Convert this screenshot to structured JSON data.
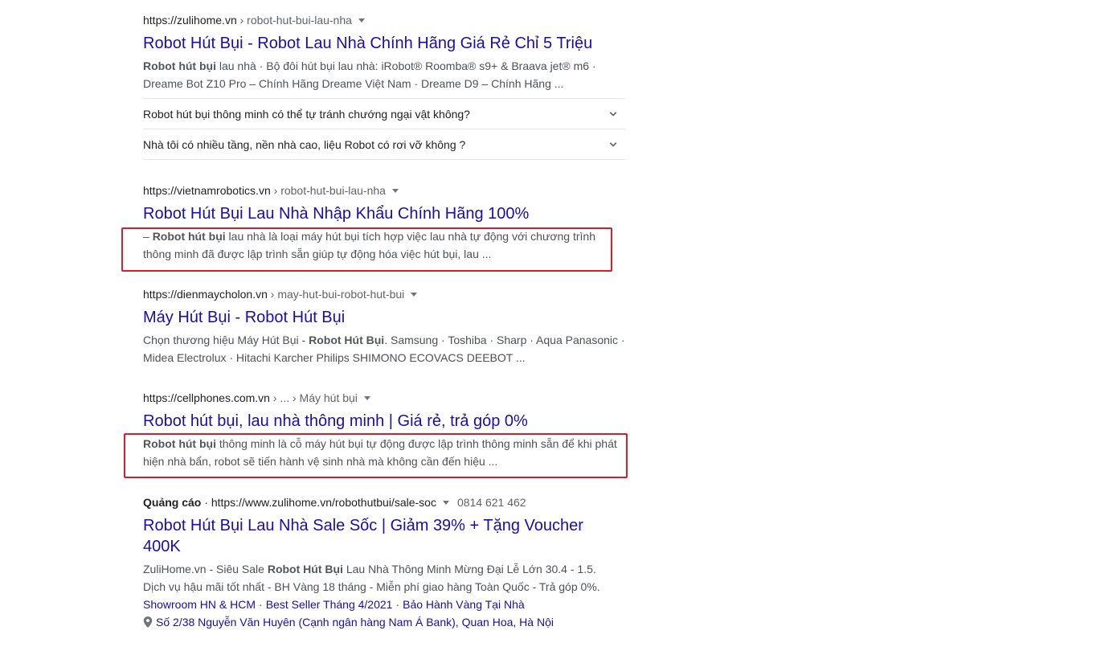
{
  "results": [
    {
      "domain": "https://zulihome.vn",
      "path": " › robot-hut-bui-lau-nha",
      "title": "Robot Hút Bụi - Robot Lau Nhà Chính Hãng Giá Rẻ Chỉ 5 Triệu",
      "snippet_bold": "Robot hút bụi",
      "snippet_line1_rest": " lau nhà · Bộ đôi hút bụi lau nhà: iRobot® Roomba® s9+ & Braava jet® m6 ·",
      "snippet_line2": "Dreame Bot Z10 Pro – Chính Hãng Dreame Việt Nam · Dreame D9 – Chính Hãng ..."
    },
    {
      "domain": "https://vietnamrobotics.vn",
      "path": " › robot-hut-bui-lau-nha",
      "title": "Robot Hút Bụi Lau Nhà Nhập Khẩu Chính Hãng 100%",
      "snippet_pre": "– ",
      "snippet_bold": "Robot hút bụi",
      "snippet_line1_rest": " lau nhà là loại máy hút bụi tích hợp việc lau nhà tự động với chương trình",
      "snippet_line2": "thông minh đã được lập trình sẵn giúp tự động hóa việc hút bụi, lau ..."
    },
    {
      "domain": "https://dienmaycholon.vn",
      "path": " › may-hut-bui-robot-hut-bui",
      "title": "Máy Hút Bụi - Robot Hút Bụi",
      "snippet_pre": "Chọn thương hiệu Máy Hút Bụi - ",
      "snippet_bold": "Robot Hút Bụi",
      "snippet_line1_rest": ". Samsung · Toshiba · Sharp · Aqua Panasonic ·",
      "snippet_line2": "Midea Electrolux · Hitachi Karcher Philips SHIMONO ECOVACS DEEBOT ..."
    },
    {
      "domain": "https://cellphones.com.vn",
      "path": " › ... › Máy hút bụi",
      "title": "Robot hút bụi, lau nhà thông minh | Giá rẻ, trả góp 0%",
      "snippet_bold": "Robot hút bụi",
      "snippet_line1_rest": " thông minh là cỗ máy hút bụi tự động được lập trình thông minh sẵn để khi phát",
      "snippet_line2": "hiện nhà bẩn, robot sẽ tiến hành vệ sinh nhà mà không cần đến hiệu ..."
    }
  ],
  "faq": [
    "Robot hút bụi thông minh có thể tự tránh chướng ngại vật không?",
    "Nhà tôi có nhiều tầng, nền nhà cao, liệu Robot có rơi vỡ không ?"
  ],
  "ad": {
    "label": "Quảng cáo",
    "dot": " · ",
    "url": "https://www.zulihome.vn/robothutbui/sale-soc",
    "phone": "0814 621 462",
    "title_line1": "Robot Hút Bụi Lau Nhà Sale Sốc | Giảm 39% + Tặng Voucher",
    "title_line2": "400K",
    "snippet_pre": "ZuliHome.vn - Siêu Sale ",
    "snippet_bold": "Robot Hút Bụi",
    "snippet_line1_rest": " Lau Nhà Thông Minh Mừng Đại Lễ Lớn 30.4 - 1.5.",
    "snippet_line2": "Dịch vụ hậu mãi tốt nhất - BH Vàng 18 tháng - Miễn phí giao hàng Toàn Quốc - Trả góp 0%.",
    "sitelinks": [
      "Showroom HN & HCM",
      "Best Seller Tháng 4/2021",
      "Bảo Hành Vàng Tại Nhà"
    ],
    "sitelink_sep": "·",
    "location": "Số 2/38 Nguyễn Văn Huyên (Cạnh ngân hàng Nam Á Bank), Quan Hoa, Hà Nội"
  },
  "colors": {
    "link": "#1a0dab",
    "highlight_box": "#d3202a"
  }
}
